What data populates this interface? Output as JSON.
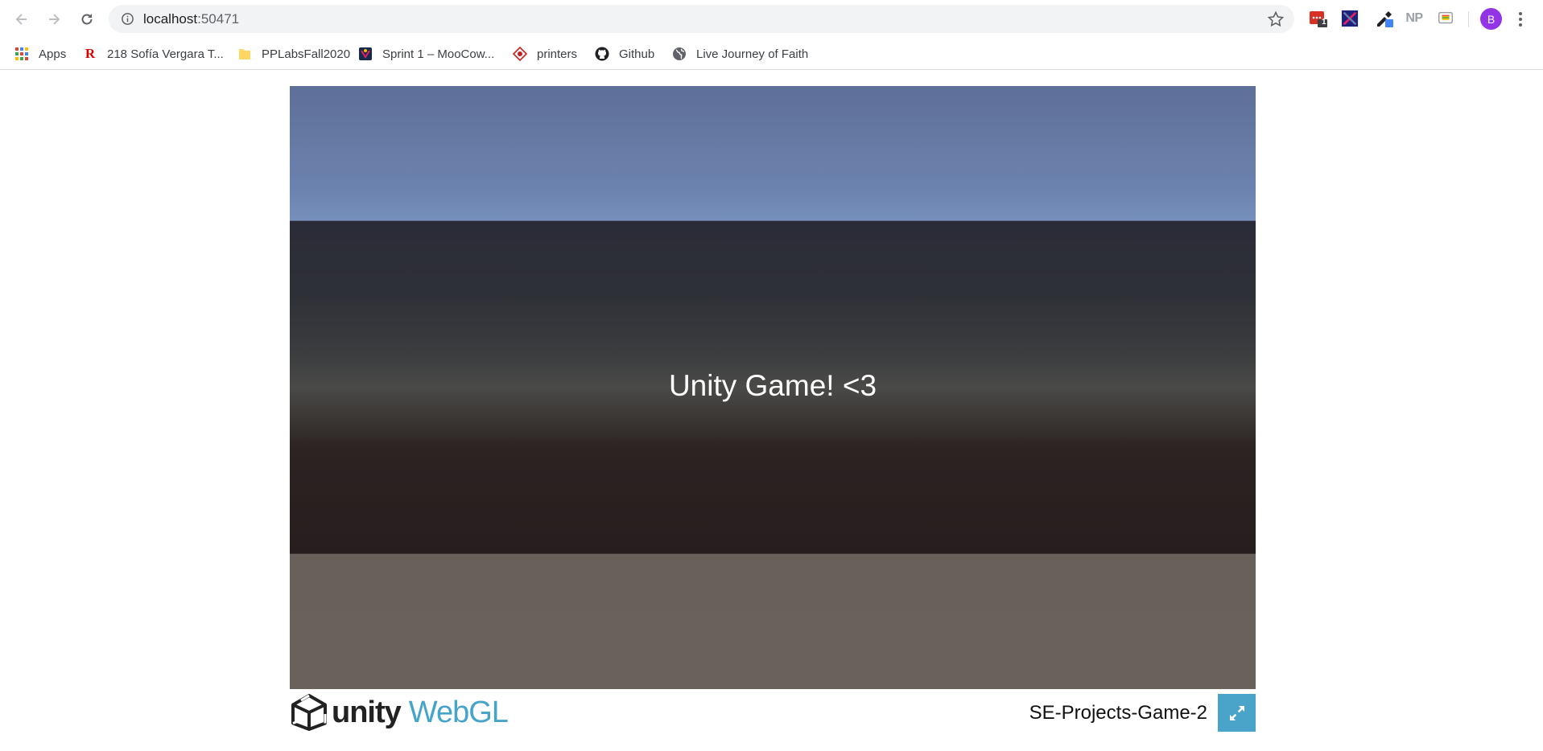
{
  "browser": {
    "url_host": "localhost",
    "url_port": ":50471",
    "extensions": {
      "badge_count": "1",
      "np_label": "NP"
    },
    "avatar_initial": "B"
  },
  "bookmarks": [
    {
      "label": "Apps",
      "icon": "apps-grid-icon"
    },
    {
      "label": "218 Sofía Vergara T...",
      "icon": "r-logo-icon"
    },
    {
      "label": "PPLabsFall2020",
      "icon": "folder-icon"
    },
    {
      "label": "Sprint 1 – MooCow...",
      "icon": "jira-icon"
    },
    {
      "label": "printers",
      "icon": "printer-site-icon"
    },
    {
      "label": "Github",
      "icon": "github-icon"
    },
    {
      "label": "Live Journey of Faith",
      "icon": "globe-icon"
    }
  ],
  "game": {
    "center_text": "Unity Game! <3"
  },
  "footer": {
    "logo_unity": "unity",
    "logo_webgl": "WebGL",
    "build_title": "SE-Projects-Game-2"
  },
  "colors": {
    "sky_top": "#5e6f98",
    "ground": "#68625b",
    "fullscreen_accent": "#4aa3c9",
    "webgl_text": "#47a4c9"
  }
}
